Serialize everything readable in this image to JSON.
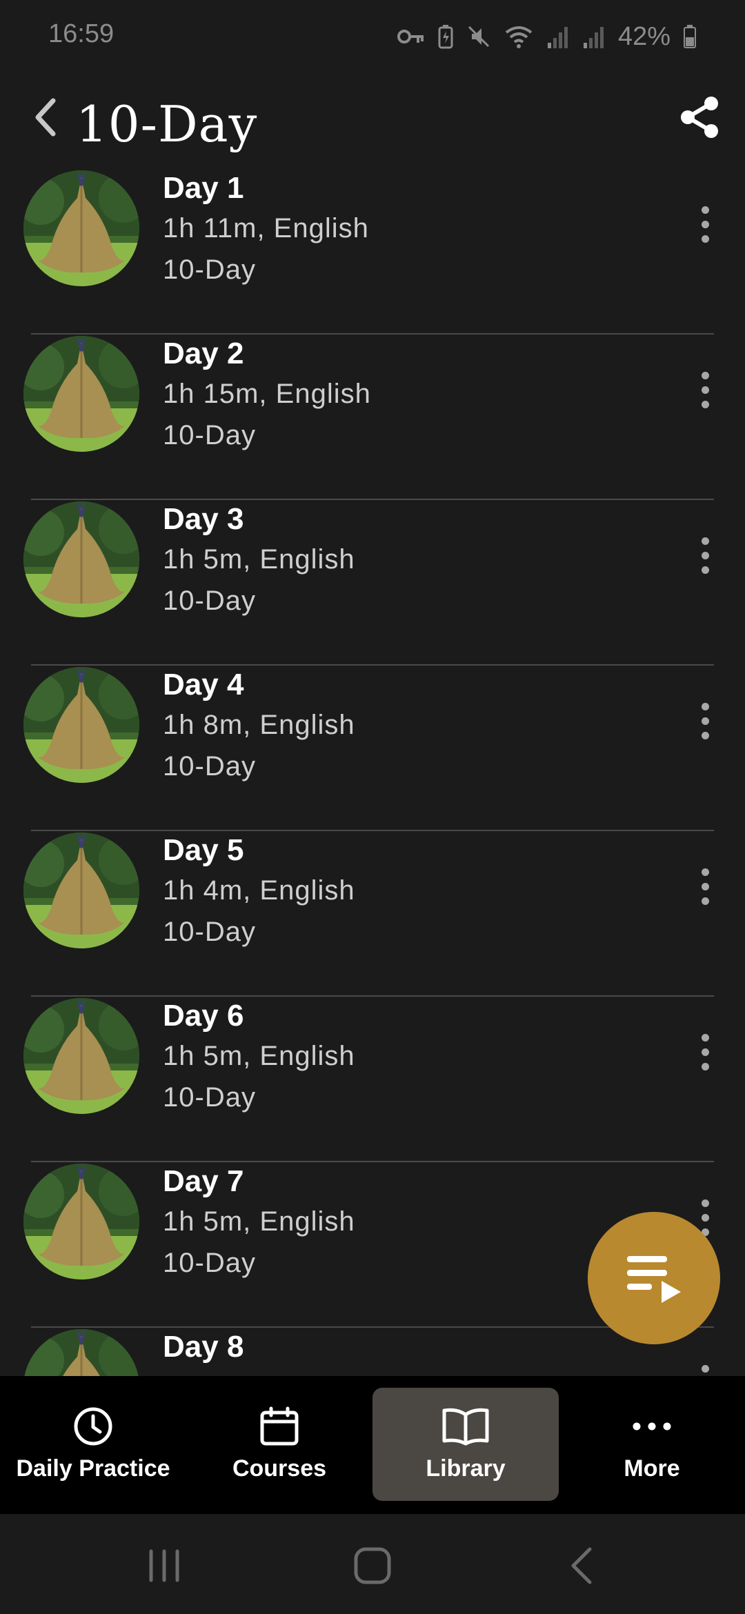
{
  "status_bar": {
    "time": "16:59",
    "battery": "42%"
  },
  "header": {
    "title": "10-Day"
  },
  "sessions": [
    {
      "name": "Day 1",
      "meta": "1h 11m, English",
      "course": "10-Day"
    },
    {
      "name": "Day 2",
      "meta": "1h 15m, English",
      "course": "10-Day"
    },
    {
      "name": "Day 3",
      "meta": "1h 5m, English",
      "course": "10-Day"
    },
    {
      "name": "Day 4",
      "meta": "1h 8m, English",
      "course": "10-Day"
    },
    {
      "name": "Day 5",
      "meta": "1h 4m, English",
      "course": "10-Day"
    },
    {
      "name": "Day 6",
      "meta": "1h 5m, English",
      "course": "10-Day"
    },
    {
      "name": "Day 7",
      "meta": "1h 5m, English",
      "course": "10-Day"
    },
    {
      "name": "Day 8",
      "meta": "",
      "course": ""
    }
  ],
  "bottom_nav": [
    {
      "label": "Daily Practice",
      "icon": "clock-icon",
      "active": false
    },
    {
      "label": "Courses",
      "icon": "calendar-icon",
      "active": false
    },
    {
      "label": "Library",
      "icon": "book-icon",
      "active": true
    },
    {
      "label": "More",
      "icon": "more-dots-icon",
      "active": false
    }
  ],
  "colors": {
    "background": "#1b1b1b",
    "accent": "#b8892f",
    "nav_active": "#4b4843"
  }
}
